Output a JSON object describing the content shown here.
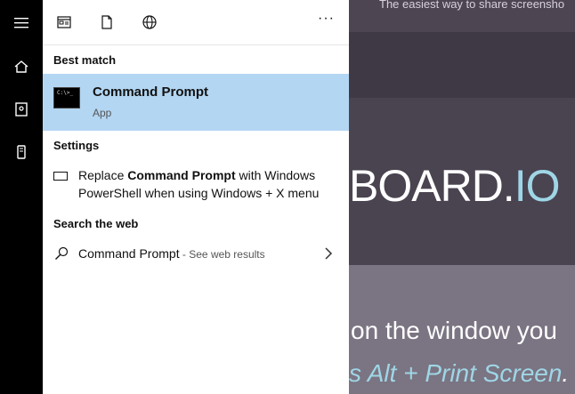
{
  "rail": {
    "items": [
      {
        "name": "hamburger-menu-icon"
      },
      {
        "name": "home-icon"
      },
      {
        "name": "notebook-icon"
      },
      {
        "name": "device-icon"
      }
    ]
  },
  "toolbar": {
    "more_label": "···"
  },
  "best_match": {
    "header": "Best match",
    "title": "Command Prompt",
    "subtitle": "App",
    "thumb_text": "C:\\>_"
  },
  "settings": {
    "header": "Settings",
    "prefix": "Replace ",
    "bold": "Command Prompt",
    "suffix": " with Windows PowerShell when using Windows + X menu"
  },
  "search_web": {
    "header": "Search the web",
    "query": "Command Prompt",
    "suffix": " - See web results"
  },
  "background": {
    "tagline": "The easiest way to share screensho",
    "brand_main": "BOARD.",
    "brand_io": "IO",
    "line1": "on the window you",
    "line2_prefix": "s ",
    "line2_keys": "Alt + Print Screen",
    "line2_end": "."
  },
  "colors": {
    "accent_selection": "#b3d6f2",
    "brand_cyan": "#9fd6e6"
  }
}
